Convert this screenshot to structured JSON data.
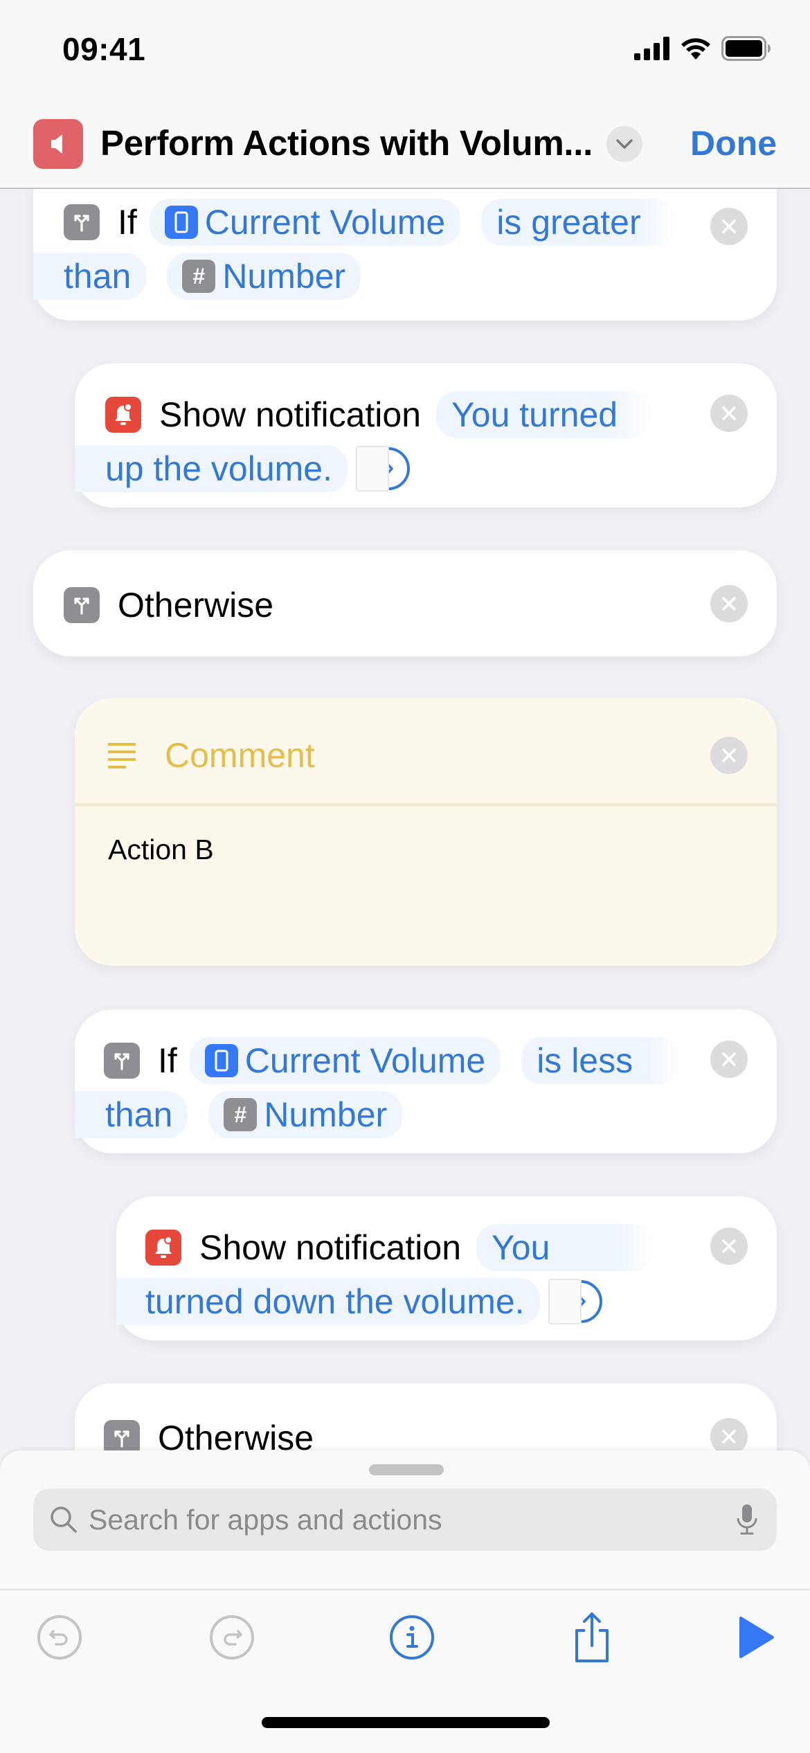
{
  "status_bar": {
    "time": "09:41"
  },
  "nav": {
    "title": "Perform Actions with Volum...",
    "app_icon": "speaker-icon",
    "app_icon_color": "#e06467",
    "done_label": "Done"
  },
  "colors": {
    "accent": "#3478d6",
    "notification_red": "#e5483a",
    "comment_yellow": "#e6bd4b"
  },
  "actions": [
    {
      "type": "if",
      "icon": "branch-icon",
      "keyword": "If",
      "variable": "Current Volume",
      "variable_icon": "phone-icon",
      "condition_line1": "is greater",
      "condition_line2": "than",
      "operand": "Number",
      "operand_icon": "hash-icon"
    },
    {
      "type": "show-notification",
      "icon": "bell-icon",
      "keyword": "Show notification",
      "text_line1": "You turned",
      "text_line2": "up the volume."
    },
    {
      "type": "otherwise",
      "icon": "branch-icon",
      "keyword": "Otherwise"
    },
    {
      "type": "comment",
      "icon": "lines-icon",
      "title": "Comment",
      "body": "Action B"
    },
    {
      "type": "if",
      "icon": "branch-icon",
      "keyword": "If",
      "variable": "Current Volume",
      "variable_icon": "phone-icon",
      "condition_line1": "is less",
      "condition_line2": "than",
      "operand": "Number",
      "operand_icon": "hash-icon"
    },
    {
      "type": "show-notification",
      "icon": "bell-icon",
      "keyword": "Show notification",
      "text_line1": "You",
      "text_line2": "turned down the volume."
    },
    {
      "type": "otherwise",
      "icon": "branch-icon",
      "keyword": "Otherwise"
    }
  ],
  "sheet": {
    "search_placeholder": "Search for apps and actions",
    "toolbar": [
      "undo-icon",
      "redo-icon",
      "info-icon",
      "share-icon",
      "play-icon"
    ]
  }
}
